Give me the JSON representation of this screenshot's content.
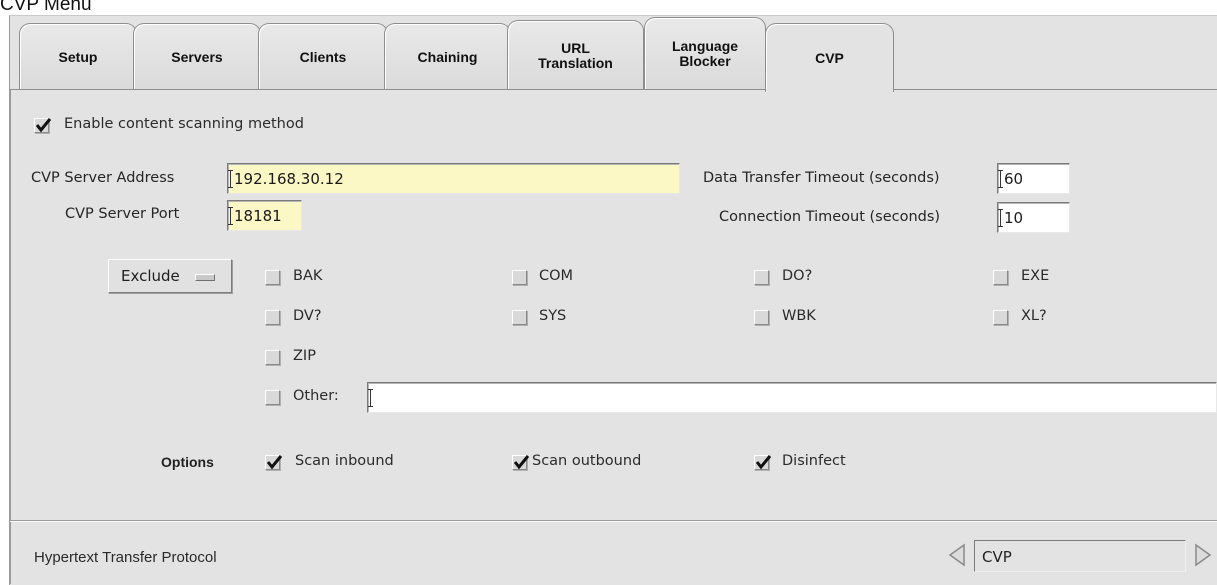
{
  "caption": "CVP  Menu",
  "tabs": [
    {
      "label": "Setup"
    },
    {
      "label": "Servers"
    },
    {
      "label": "Clients"
    },
    {
      "label": "Chaining"
    },
    {
      "label": "URL\nTranslation"
    },
    {
      "label": "Language\nBlocker"
    },
    {
      "label": "CVP",
      "active": true
    }
  ],
  "enable": {
    "label": "Enable content scanning method",
    "checked": true
  },
  "server": {
    "address_label": "CVP Server Address",
    "address_value": "192.168.30.12",
    "port_label": "CVP Server Port",
    "port_value": "18181"
  },
  "timeouts": {
    "data_label": "Data Transfer Timeout (seconds)",
    "data_value": "60",
    "connection_label": "Connection Timeout (seconds)",
    "connection_value": "10"
  },
  "exclude": {
    "button_label": "Exclude",
    "extensions": [
      "BAK",
      "COM",
      "DO?",
      "EXE",
      "DV?",
      "SYS",
      "WBK",
      "XL?",
      "ZIP"
    ],
    "other_label": "Other:",
    "other_value": ""
  },
  "options": {
    "label": "Options",
    "items": [
      {
        "label": "Scan inbound",
        "checked": true
      },
      {
        "label": "Scan outbound",
        "checked": true
      },
      {
        "label": "Disinfect",
        "checked": true
      }
    ]
  },
  "status": {
    "text": "Hypertext Transfer Protocol",
    "nav_value": "CVP"
  },
  "colors": {
    "field_yellow": "#fcf8c6",
    "panel_bg": "#e3e3e3"
  }
}
